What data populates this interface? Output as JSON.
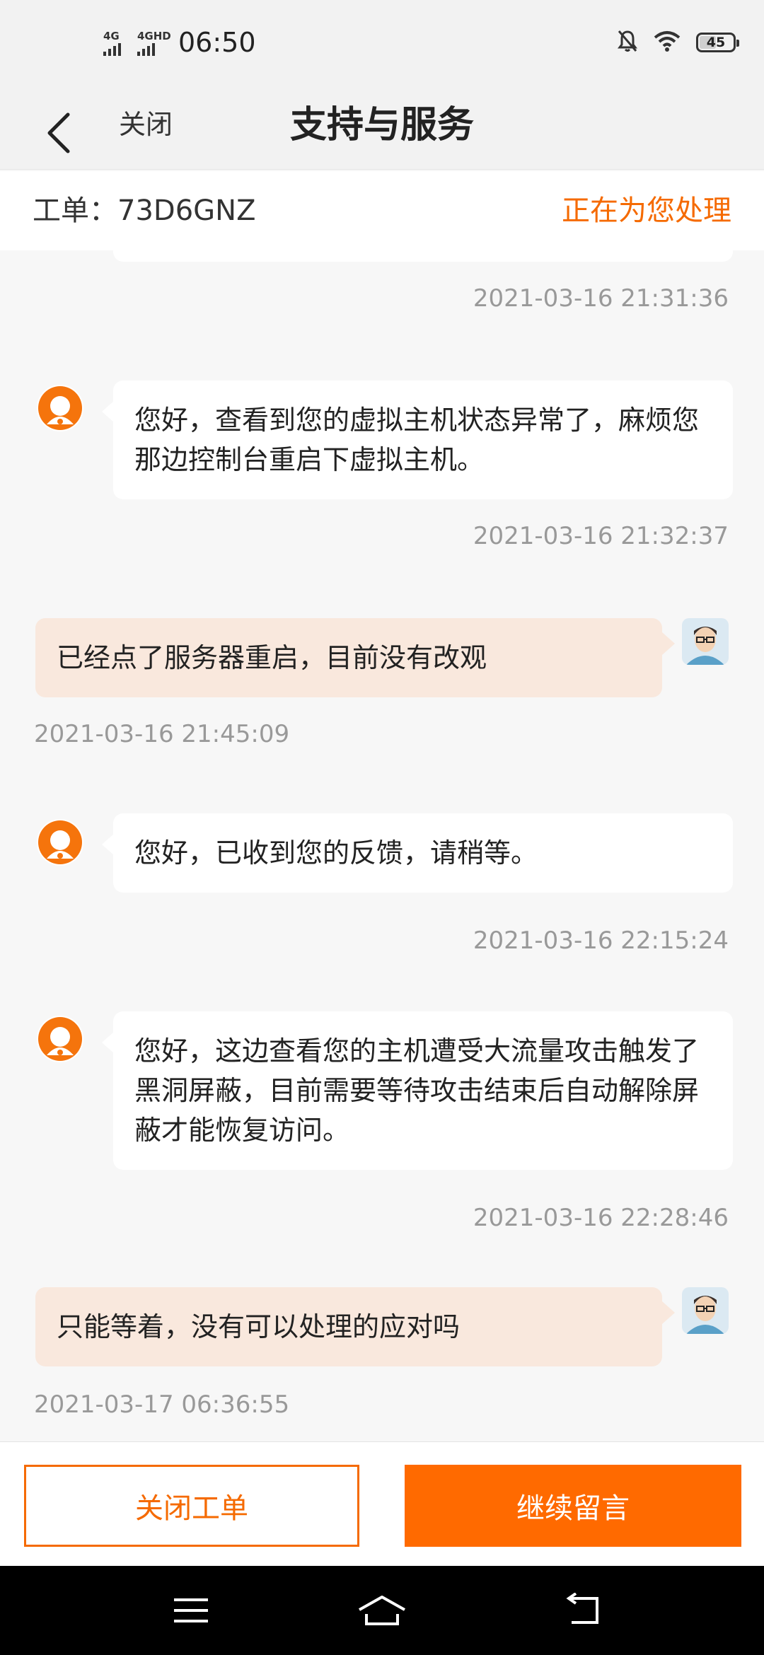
{
  "status_bar": {
    "signal1_label": "4G",
    "signal2_label": "4GHD",
    "time": "06:50",
    "battery_level": "45",
    "icons": [
      "mute-bell-icon",
      "wifi-icon",
      "battery-icon"
    ]
  },
  "nav": {
    "close_label": "关闭",
    "title": "支持与服务"
  },
  "ticket": {
    "label": "工单：73D6GNZ",
    "status": "正在为您处理"
  },
  "messages": [
    {
      "from": "agent",
      "text": "",
      "time": "2021-03-16 21:31:36"
    },
    {
      "from": "agent",
      "text": "您好，查看到您的虚拟主机状态异常了，麻烦您那边控制台重启下虚拟主机。",
      "time": "2021-03-16 21:32:37"
    },
    {
      "from": "user",
      "text": "已经点了服务器重启，目前没有改观",
      "time": "2021-03-16 21:45:09"
    },
    {
      "from": "agent",
      "text": "您好，已收到您的反馈，请稍等。",
      "time": "2021-03-16 22:15:24"
    },
    {
      "from": "agent",
      "text": "您好，这边查看您的主机遭受大流量攻击触发了黑洞屏蔽，目前需要等待攻击结束后自动解除屏蔽才能恢复访问。",
      "time": "2021-03-16 22:28:46"
    },
    {
      "from": "user",
      "text": "只能等着，没有可以处理的应对吗",
      "time": "2021-03-17 06:36:55"
    }
  ],
  "actions": {
    "close_ticket": "关闭工单",
    "continue_message": "继续留言"
  },
  "colors": {
    "accent": "#ff6a00",
    "user_bubble": "#f9e8dd",
    "background": "#f7f7f7"
  }
}
